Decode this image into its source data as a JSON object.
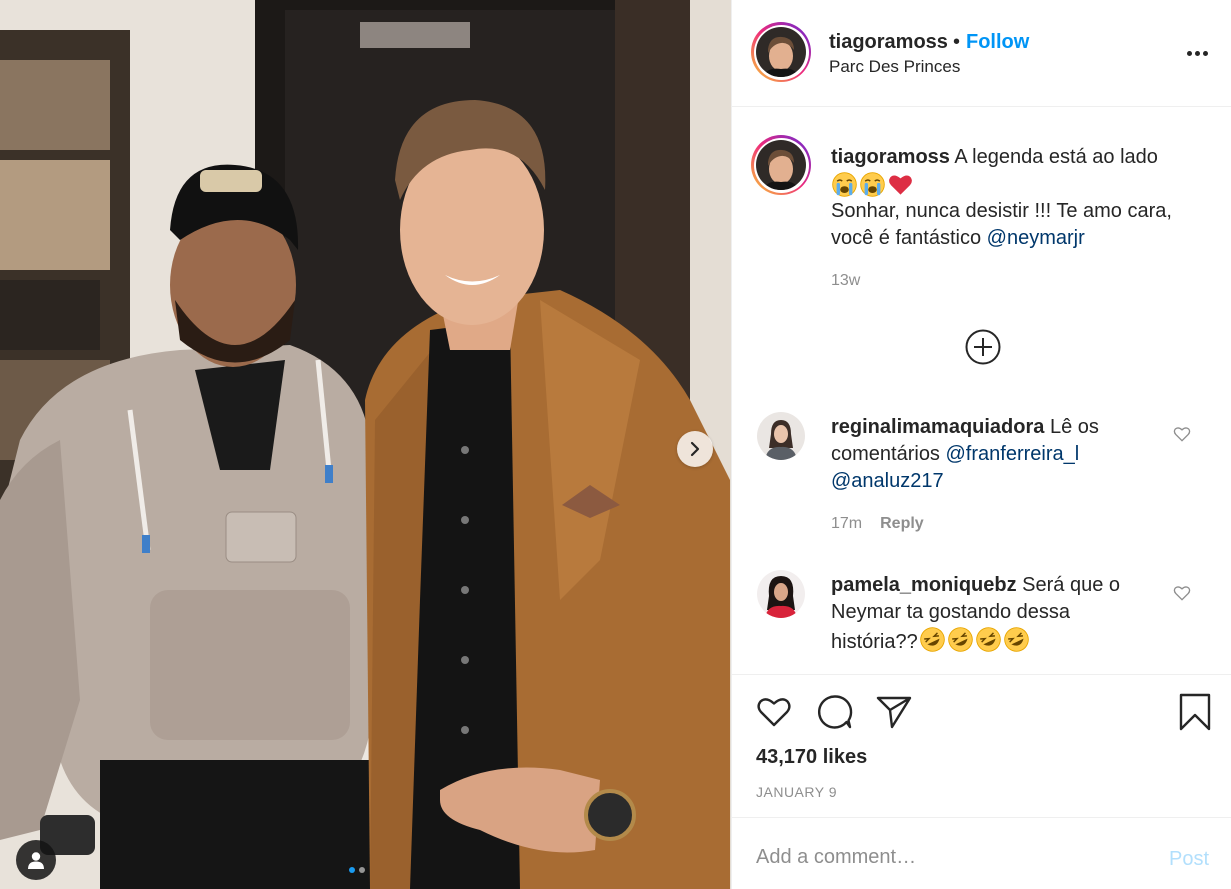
{
  "post": {
    "username": "tiagoramoss",
    "separator": "•",
    "follow_label": "Follow",
    "location": "Parc Des Princes",
    "more_icon": "more-options-icon"
  },
  "caption": {
    "username": "tiagoramoss",
    "line1": "A legenda está ao lado",
    "emojis": [
      "loudly-crying-face",
      "loudly-crying-face",
      "red-heart"
    ],
    "line2": "Sonhar, nunca desistir !!! Te amo cara, você é fantástico ",
    "mention": "@neymarjr",
    "time": "13w"
  },
  "load_more_icon": "plus-circle-icon",
  "comments": [
    {
      "username": "reginalimamaquiadora",
      "text": " Lê os comentários ",
      "mention1": "@franferreira_l",
      "mention2": "@analuz217",
      "time": "17m",
      "reply_label": "Reply"
    },
    {
      "username": "pamela_moniquebz",
      "text": " Será que o Neymar ta gostando dessa história??",
      "emojis": [
        "rolling-on-floor-laughing",
        "rolling-on-floor-laughing",
        "rolling-on-floor-laughing",
        "rolling-on-floor-laughing"
      ]
    }
  ],
  "actions": {
    "like_icon": "heart-icon",
    "comment_icon": "comment-icon",
    "share_icon": "paper-plane-icon",
    "save_icon": "bookmark-icon"
  },
  "likes": "43,170 likes",
  "date": "JANUARY 9",
  "comment_box": {
    "placeholder": "Add a comment…",
    "post_label": "Post"
  },
  "carousel": {
    "slides": 2,
    "active": 0
  },
  "colors": {
    "link": "#0095f6",
    "mention": "#00376b",
    "muted": "#8e8e8e",
    "post_disabled": "#b2dffc",
    "border": "#efefef"
  }
}
